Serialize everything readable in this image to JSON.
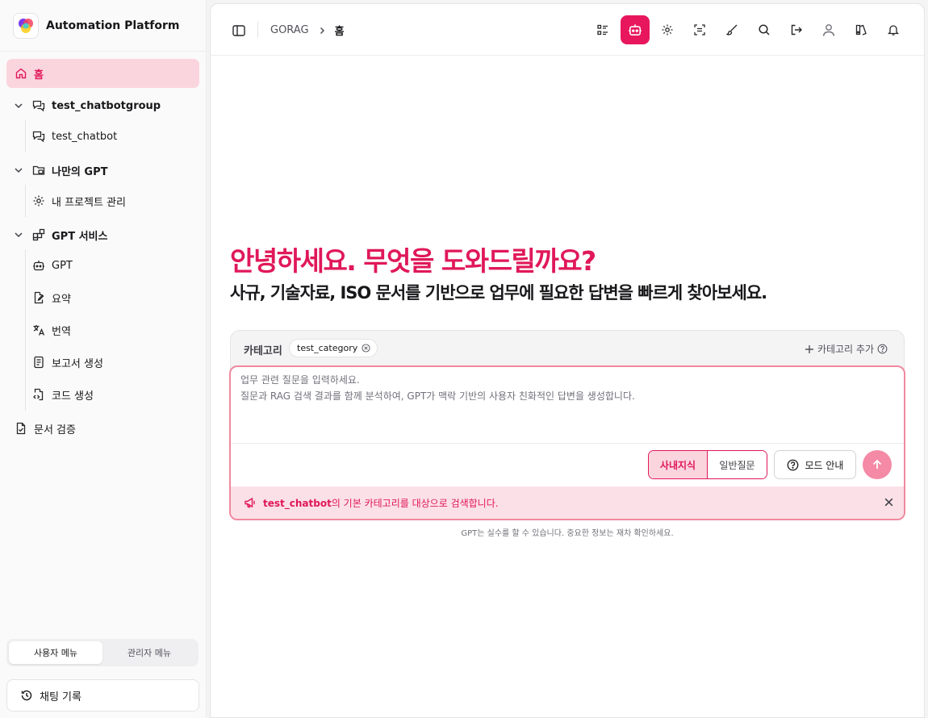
{
  "app": {
    "title": "Automation Platform"
  },
  "sidebar": {
    "items": [
      {
        "label": "홈",
        "icon": "home-icon",
        "active": true
      },
      {
        "label": "test_chatbotgroup",
        "icon": "chat-group-icon",
        "expanded": true
      },
      {
        "label": "test_chatbot",
        "icon": "chat-icon"
      },
      {
        "label": "나만의 GPT",
        "icon": "folder-bot-icon",
        "expanded": true
      },
      {
        "label": "내 프로젝트 관리",
        "icon": "gear-icon"
      },
      {
        "label": "GPT 서비스",
        "icon": "apps-icon",
        "expanded": true
      },
      {
        "label": "GPT",
        "icon": "bot-icon"
      },
      {
        "label": "요약",
        "icon": "document-edit-icon"
      },
      {
        "label": "번역",
        "icon": "translate-icon"
      },
      {
        "label": "보고서 생성",
        "icon": "report-icon"
      },
      {
        "label": "코드 생성",
        "icon": "code-file-icon"
      },
      {
        "label": "문서 검증",
        "icon": "file-check-icon"
      }
    ],
    "menu_toggle": {
      "user": "사용자 메뉴",
      "admin": "관리자 메뉴",
      "selected": "user"
    },
    "history_label": "채팅 기록"
  },
  "header": {
    "breadcrumb": [
      "GORAG",
      "홈"
    ],
    "tools": [
      "list-icon",
      "bot-icon",
      "gear-icon",
      "scan-icon",
      "brush-icon",
      "search-icon",
      "logout-icon",
      "user-icon",
      "theme-icon",
      "bell-icon"
    ],
    "active_tool": "bot-icon"
  },
  "main": {
    "title": "안녕하세요. 무엇을 도와드릴까요?",
    "subtitle": "사규, 기술자료, ISO 문서를 기반으로 업무에 필요한 답변을 빠르게 찾아보세요.",
    "category": {
      "label": "카테고리",
      "chips": [
        "test_category"
      ],
      "add_label": "카테고리 추가"
    },
    "input": {
      "placeholder": "업무 관련 질문을 입력하세요.\n질문과 RAG 검색 결과를 함께 분석하여, GPT가 맥락 기반의 사용자 친화적인 답변을 생성합니다.",
      "value": ""
    },
    "modes": {
      "internal": "사내지식",
      "general": "일반질문",
      "selected": "internal"
    },
    "mode_guide_label": "모드 안내",
    "notice": {
      "bold": "test_chatbot",
      "text": "의 기본 카테고리를 대상으로 검색합니다."
    },
    "disclaimer": "GPT는 실수를 할 수 있습니다. 중요한 정보는 재차 확인하세요."
  },
  "colors": {
    "accent": "#e0185a",
    "accent_soft": "#fbd5de",
    "send_button": "#f48aa6"
  }
}
